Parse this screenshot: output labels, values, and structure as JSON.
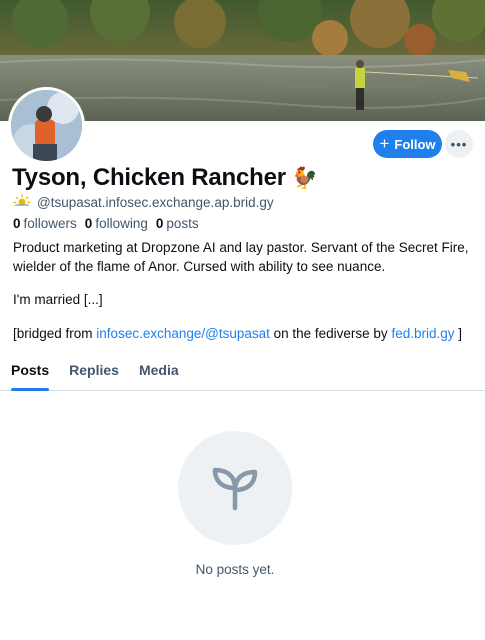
{
  "profile": {
    "display_name": "Tyson, Chicken Rancher",
    "name_emoji": "🐓",
    "handle": "@tsupasat.infosec.exchange.ap.brid.gy",
    "handle_icon": "sun-cloud-icon",
    "followers_count": "0",
    "followers_label": "followers",
    "following_count": "0",
    "following_label": "following",
    "posts_count": "0",
    "posts_label": "posts"
  },
  "actions": {
    "follow_label": "Follow",
    "more_label": "•••"
  },
  "bio": {
    "line1": "Product marketing at Dropzone AI and lay pastor. Servant of the Secret Fire, wielder of the flame of Anor. Cursed with ability to see nuance.",
    "line2": "I'm married [...]",
    "bridged_prefix": "[bridged from ",
    "bridged_link": "infosec.exchange/@tsupasat",
    "bridged_middle": " on the fediverse by ",
    "bridged_site": "fed.brid.gy",
    "bridged_suffix": " ]"
  },
  "tabs": [
    {
      "label": "Posts",
      "active": true
    },
    {
      "label": "Replies",
      "active": false
    },
    {
      "label": "Media",
      "active": false
    }
  ],
  "empty_state": {
    "icon": "seedling-icon",
    "text": "No posts yet."
  },
  "colors": {
    "accent": "#1f80ec",
    "muted_text": "#42576c",
    "empty_circle": "#eef1f4"
  }
}
